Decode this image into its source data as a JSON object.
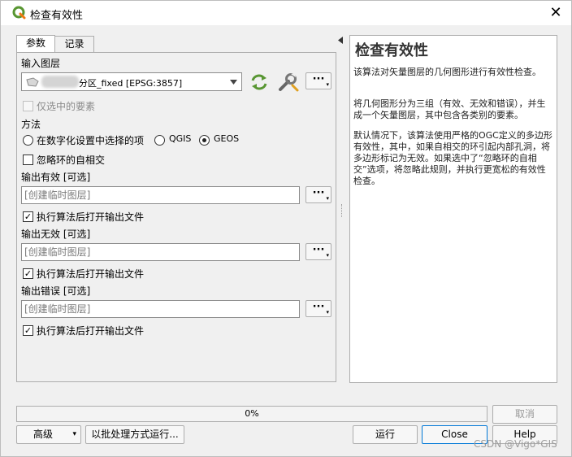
{
  "window": {
    "title": "检查有效性",
    "close_icon": "✕"
  },
  "tabs": {
    "params": "参数",
    "log": "记录"
  },
  "input_layer": {
    "label": "输入图层",
    "value": "分区_fixed [EPSG:3857]",
    "iterate_icon": "iterate-icon",
    "settings_icon": "wrench-icon",
    "dots": "···"
  },
  "selected_only": {
    "label": "仅选中的要素",
    "checked": false,
    "enabled": false
  },
  "method": {
    "label": "方法",
    "options": [
      {
        "label": "在数字化设置中选择的项",
        "selected": false
      },
      {
        "label": "QGIS",
        "selected": false
      },
      {
        "label": "GEOS",
        "selected": true
      }
    ]
  },
  "ignore_ring": {
    "label": "忽略环的自相交",
    "checked": false
  },
  "outputs": [
    {
      "label": "输出有效 [可选]",
      "placeholder": "[创建临时图层]",
      "open_label": "执行算法后打开输出文件",
      "open_checked": true
    },
    {
      "label": "输出无效 [可选]",
      "placeholder": "[创建临时图层]",
      "open_label": "执行算法后打开输出文件",
      "open_checked": true
    },
    {
      "label": "输出错误 [可选]",
      "placeholder": "[创建临时图层]",
      "open_label": "执行算法后打开输出文件",
      "open_checked": true
    }
  ],
  "help": {
    "title": "检查有效性",
    "p1": "该算法对矢量图层的几何图形进行有效性检查。",
    "p2": "将几何图形分为三组（有效、无效和错误），并生成一个矢量图层，其中包含各类别的要素。",
    "p3": "默认情况下，该算法使用严格的OGC定义的多边形有效性，其中，如果自相交的环引起内部孔洞，将多边形标记为无效。如果选中了“忽略环的自相交”选项，将忽略此规则，并执行更宽松的有效性检查。"
  },
  "progress": {
    "value": 0,
    "text": "0%"
  },
  "buttons": {
    "cancel": "取消",
    "advanced": "高级",
    "batch": "以批处理方式运行...",
    "run": "运行",
    "close": "Close",
    "help": "Help"
  },
  "watermark": "CSDN @Vigo*GIS",
  "colors": {
    "qgis_green": "#589632",
    "qgis_yellow": "#ee7913",
    "focus_blue": "#0078d7"
  }
}
